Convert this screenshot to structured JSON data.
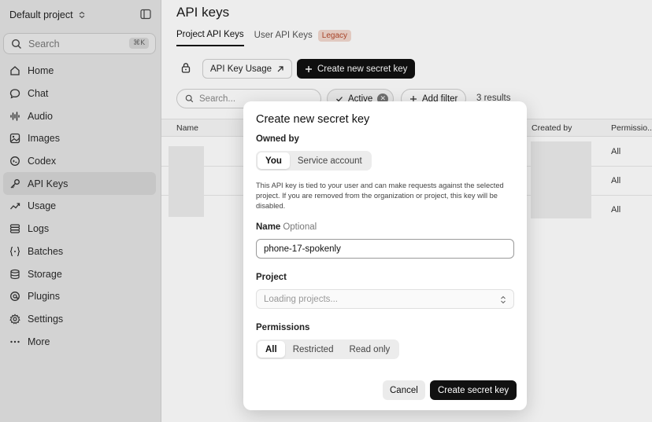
{
  "sidebar": {
    "project_name": "Default project",
    "search_placeholder": "Search",
    "search_shortcut": "⌘K",
    "items": [
      {
        "label": "Home",
        "icon": "home-icon"
      },
      {
        "label": "Chat",
        "icon": "chat-icon"
      },
      {
        "label": "Audio",
        "icon": "audio-icon"
      },
      {
        "label": "Images",
        "icon": "images-icon"
      },
      {
        "label": "Codex",
        "icon": "codex-icon"
      },
      {
        "label": "API Keys",
        "icon": "key-icon",
        "active": true
      },
      {
        "label": "Usage",
        "icon": "usage-icon"
      },
      {
        "label": "Logs",
        "icon": "logs-icon"
      },
      {
        "label": "Batches",
        "icon": "batches-icon"
      },
      {
        "label": "Storage",
        "icon": "storage-icon"
      },
      {
        "label": "Plugins",
        "icon": "plugins-icon"
      },
      {
        "label": "Settings",
        "icon": "settings-icon"
      },
      {
        "label": "More",
        "icon": "more-icon"
      }
    ]
  },
  "main": {
    "title": "API keys",
    "tabs": [
      {
        "label": "Project API Keys",
        "active": true
      },
      {
        "label": "User API Keys"
      }
    ],
    "legacy_badge": "Legacy",
    "usage_button": "API Key Usage",
    "create_button": "Create new secret key",
    "search_placeholder": "Search...",
    "filter_chip": "Active",
    "add_filter": "Add filter",
    "results": "3 results",
    "columns": {
      "name": "Name",
      "created_by": "Created by",
      "permissions": "Permissio..."
    },
    "rows": [
      {
        "permissions": "All"
      },
      {
        "permissions": "All"
      },
      {
        "permissions": "All"
      }
    ]
  },
  "modal": {
    "title": "Create new secret key",
    "owned_by_label": "Owned by",
    "owned_by_options": [
      "You",
      "Service account"
    ],
    "owned_by_selected": "You",
    "description": "This API key is tied to your user and can make requests against the selected project. If you are removed from the organization or project, this key will be disabled.",
    "name_label": "Name",
    "name_optional": "Optional",
    "name_value": "phone-17-spokenly",
    "project_label": "Project",
    "project_placeholder": "Loading projects...",
    "permissions_label": "Permissions",
    "permissions_options": [
      "All",
      "Restricted",
      "Read only"
    ],
    "permissions_selected": "All",
    "cancel": "Cancel",
    "submit": "Create secret key"
  }
}
